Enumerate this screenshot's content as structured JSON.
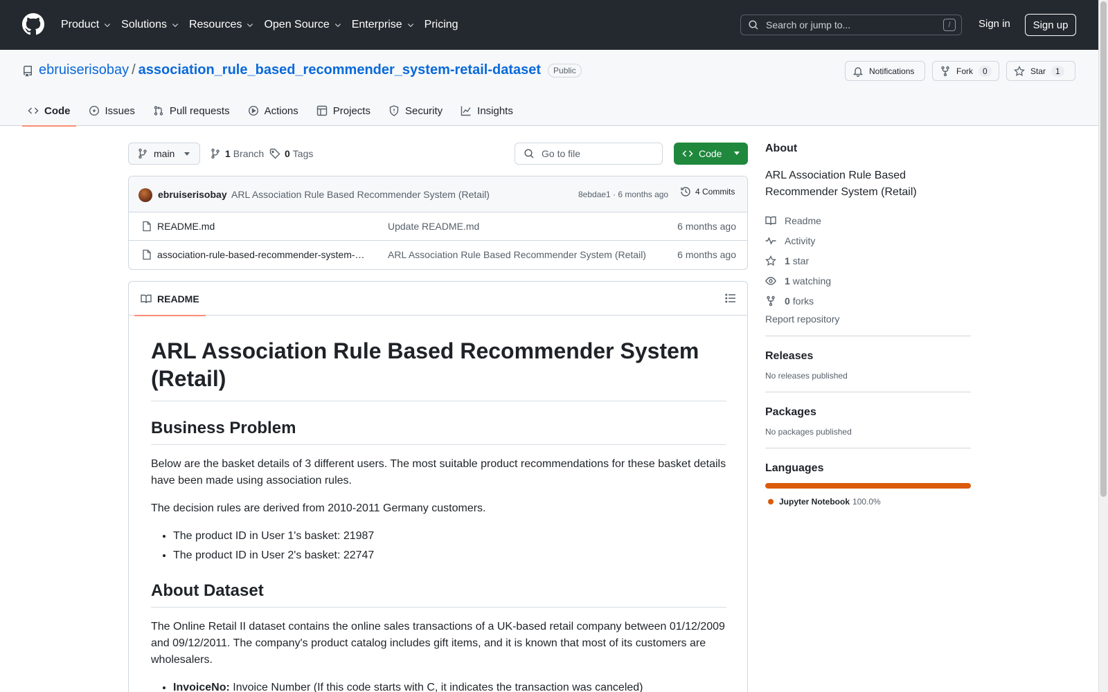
{
  "header": {
    "nav": [
      {
        "label": "Product",
        "dropdown": true
      },
      {
        "label": "Solutions",
        "dropdown": true
      },
      {
        "label": "Resources",
        "dropdown": true
      },
      {
        "label": "Open Source",
        "dropdown": true
      },
      {
        "label": "Enterprise",
        "dropdown": true
      },
      {
        "label": "Pricing",
        "dropdown": false
      }
    ],
    "search_placeholder": "Search or jump to...",
    "search_shortcut": "/",
    "sign_in": "Sign in",
    "sign_up": "Sign up"
  },
  "repo": {
    "owner": "ebruiserisobay",
    "separator": "/",
    "name": "association_rule_based_recommender_system-retail-dataset",
    "visibility": "Public",
    "notifications_label": "Notifications",
    "fork_label": "Fork",
    "fork_count": "0",
    "star_label": "Star",
    "star_count": "1"
  },
  "tabs": [
    {
      "label": "Code",
      "icon": "code-icon",
      "active": true
    },
    {
      "label": "Issues",
      "icon": "issue-icon"
    },
    {
      "label": "Pull requests",
      "icon": "pull-request-icon"
    },
    {
      "label": "Actions",
      "icon": "play-icon"
    },
    {
      "label": "Projects",
      "icon": "table-icon"
    },
    {
      "label": "Security",
      "icon": "shield-icon"
    },
    {
      "label": "Insights",
      "icon": "graph-icon"
    }
  ],
  "toolbar": {
    "branch": "main",
    "branch_count": "1",
    "branch_label": "Branch",
    "tag_count": "0",
    "tag_label": "Tags",
    "go_to_file": "Go to file",
    "code_button": "Code"
  },
  "commit": {
    "author": "ebruiserisobay",
    "message": "ARL Association Rule Based Recommender System (Retail)",
    "hash_time": "8ebdae1 · 6 months ago",
    "commits": "4 Commits"
  },
  "files": [
    {
      "name": "README.md",
      "message": "Update README.md",
      "date": "6 months ago"
    },
    {
      "name": "association-rule-based-recommender-system-…",
      "message": "ARL Association Rule Based Recommender System (Retail)",
      "date": "6 months ago"
    }
  ],
  "readme": {
    "tab_label": "README",
    "title": "ARL Association Rule Based Recommender System (Retail)",
    "h2_problem": "Business Problem",
    "p1": "Below are the basket details of 3 different users. The most suitable product recommendations for these basket details have been made using association rules.",
    "p2": "The decision rules are derived from 2010-2011 Germany customers.",
    "list1": [
      "The product ID in User 1's basket: 21987",
      "The product ID in User 2's basket: 22747"
    ],
    "h2_dataset": "About Dataset",
    "p3": "The Online Retail II dataset contains the online sales transactions of a UK-based retail company between 01/12/2009 and 09/12/2011. The company's product catalog includes gift items, and it is known that most of its customers are wholesalers.",
    "field_name": "InvoiceNo:",
    "field_desc": " Invoice Number (If this code starts with C, it indicates the transaction was canceled)"
  },
  "sidebar": {
    "about_title": "About",
    "about_desc": "ARL Association Rule Based Recommender System (Retail)",
    "readme": "Readme",
    "activity": "Activity",
    "stars_count": "1",
    "stars_label": "star",
    "watching_count": "1",
    "watching_label": "watching",
    "forks_count": "0",
    "forks_label": "forks",
    "report": "Report repository",
    "releases_title": "Releases",
    "releases_empty": "No releases published",
    "packages_title": "Packages",
    "packages_empty": "No packages published",
    "languages_title": "Languages",
    "language_name": "Jupyter Notebook",
    "language_pct": "100.0%",
    "language_color": "#da5b0b"
  }
}
